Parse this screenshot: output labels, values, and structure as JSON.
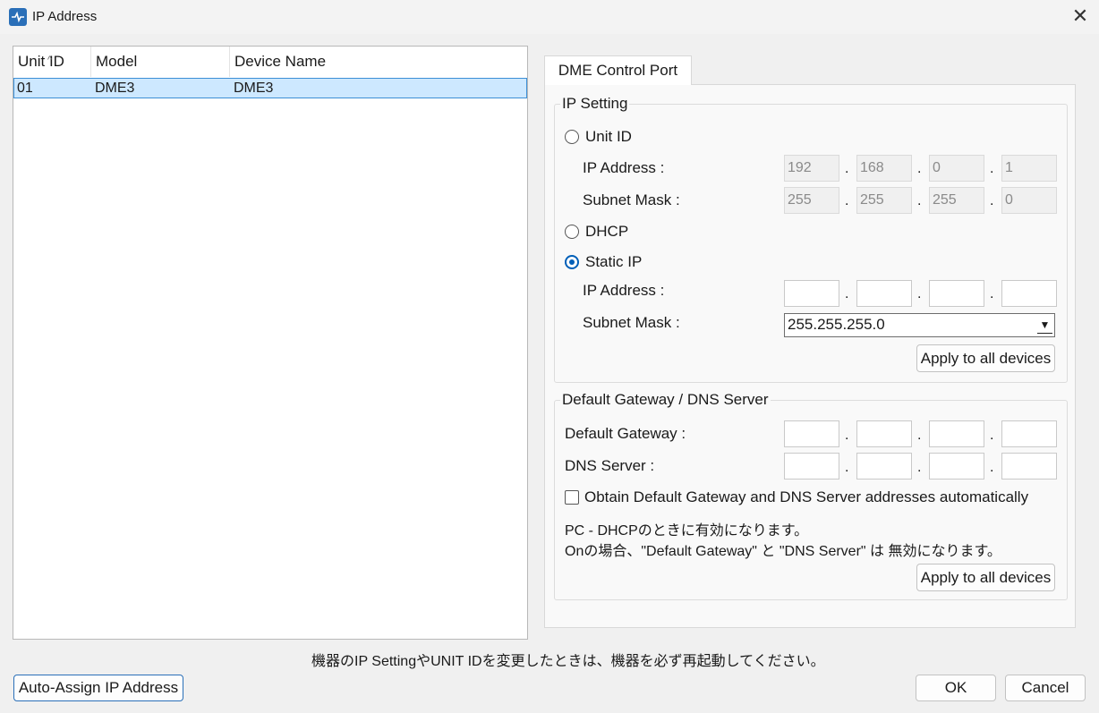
{
  "window": {
    "title": "IP Address",
    "close_glyph": "✕",
    "icon": "app-icon"
  },
  "list": {
    "columns": [
      "Unit ID",
      "Model",
      "Device Name"
    ],
    "rows": [
      {
        "unit_id": "01",
        "model": "DME3",
        "device_name": "DME3"
      }
    ]
  },
  "tab": {
    "label": "DME Control Port"
  },
  "ip_setting": {
    "legend": "IP Setting",
    "unit_id_radio": "Unit ID",
    "ip_address_label": "IP Address :",
    "subnet_mask_label": "Subnet Mask :",
    "unit_ip": [
      "192",
      "168",
      "0",
      "1"
    ],
    "unit_mask": [
      "255",
      "255",
      "255",
      "0"
    ],
    "dhcp_radio": "DHCP",
    "static_ip_radio": "Static IP",
    "static_ip_label": "IP Address :",
    "static_mask_label": "Subnet Mask :",
    "static_mask_value": "255.255.255.0",
    "selected_mode": "Static IP",
    "apply_button": "Apply to all devices"
  },
  "gateway": {
    "legend": "Default Gateway / DNS Server",
    "gateway_label": "Default Gateway :",
    "dns_label": "DNS Server :",
    "auto_checkbox": "Obtain Default Gateway and DNS Server addresses automatically",
    "note_line1": "PC - DHCPのときに有効になります。",
    "note_line2": "Onの場合、\"Default Gateway\" と \"DNS Server\" は 無効になります。",
    "apply_button": "Apply to all devices"
  },
  "footer": {
    "notice": "機器のIP SettingやUNIT IDを変更したときは、機器を必ず再起動してください。",
    "auto_assign_button": "Auto-Assign IP Address",
    "ok_button": "OK",
    "cancel_button": "Cancel"
  },
  "dot": "."
}
